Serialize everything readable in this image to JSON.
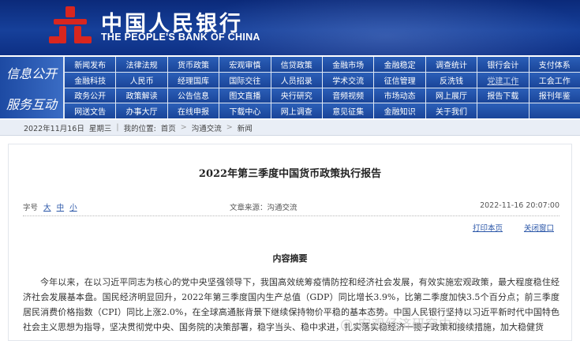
{
  "header": {
    "logo_cn": "中国人民银行",
    "logo_en": "THE PEOPLE'S BANK OF CHINA",
    "brand_color": "#12398f",
    "emblem_color": "#d8261f"
  },
  "nav": {
    "section1_label": "信息公开",
    "section2_label": "服务互动",
    "rows": [
      [
        "新闻发布",
        "法律法规",
        "货币政策",
        "宏观审慎",
        "信贷政策",
        "金融市场",
        "金融稳定",
        "调查统计",
        "银行会计",
        "支付体系"
      ],
      [
        "金融科技",
        "人民币",
        "经理国库",
        "国际交往",
        "人员招录",
        "学术交流",
        "征信管理",
        "反洗钱",
        "党建工作",
        "工会工作"
      ],
      [
        "政务公开",
        "政策解读",
        "公告信息",
        "图文直播",
        "央行研究",
        "音频视频",
        "市场动态",
        "网上展厅",
        "报告下载",
        "报刊年鉴"
      ],
      [
        "网送文告",
        "办事大厅",
        "在线申报",
        "下载中心",
        "网上调查",
        "意见征集",
        "金融知识",
        "关于我们",
        "",
        ""
      ]
    ]
  },
  "breadcrumb": {
    "date": "2022年11月16日",
    "weekday": "星期三",
    "location_label": "我的位置:",
    "home": "首页",
    "level1": "沟通交流",
    "level2": "新闻"
  },
  "article": {
    "title": "2022年第三季度中国货币政策执行报告",
    "font_size_label": "字号",
    "font_large": "大",
    "font_medium": "中",
    "font_small": "小",
    "source": "文章来源：沟通交流",
    "datetime": "2022-11-16 20:07:00",
    "print_link": "打印本页",
    "close_link": "关闭窗口",
    "summary_heading": "内容摘要",
    "body": "今年以来，在以习近平同志为核心的党中央坚强领导下，我国高效统筹疫情防控和经济社会发展，有效实施宏观政策，最大程度稳住经济社会发展基本盘。国民经济明显回升，2022年第三季度国内生产总值（GDP）同比增长3.9%，比第二季度加快3.5个百分点；前三季度居民消费价格指数（CPI）同比上涨2.0%，在全球高通胀背景下继续保持物价平稳的基本态势。中国人民银行坚持以习近平新时代中国特色社会主义思想为指导，坚决贯彻党中央、国务院的决策部署，稳字当头、稳中求进，扎实落实稳经济一揽子政策和接续措施，加大稳健货",
    "watermark": "@ 宏观经济研究中心"
  }
}
